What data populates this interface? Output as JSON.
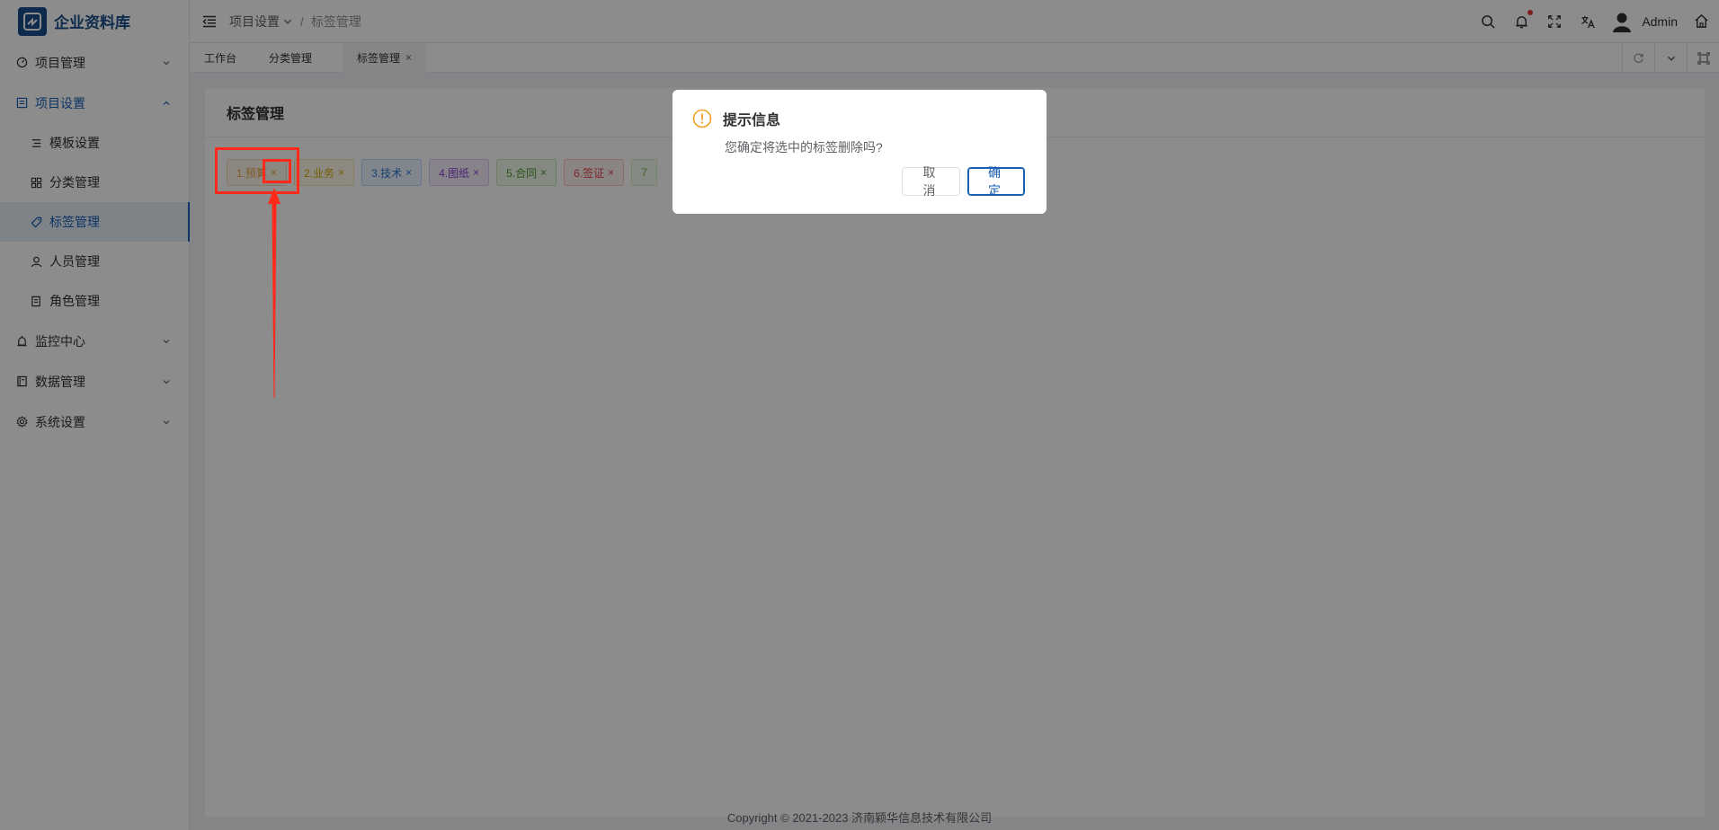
{
  "app": {
    "title": "企业资料库"
  },
  "sidebar": {
    "items": [
      {
        "label": "项目管理",
        "icon": "gauge-icon"
      },
      {
        "label": "项目设置",
        "icon": "document-icon"
      },
      {
        "label": "监控中心",
        "icon": "alarm-icon"
      },
      {
        "label": "数据管理",
        "icon": "book-icon"
      },
      {
        "label": "系统设置",
        "icon": "gear-icon"
      }
    ],
    "sub_items": [
      {
        "label": "模板设置",
        "icon": "list-icon"
      },
      {
        "label": "分类管理",
        "icon": "grid-icon"
      },
      {
        "label": "标签管理",
        "icon": "tag-icon"
      },
      {
        "label": "人员管理",
        "icon": "user-icon"
      },
      {
        "label": "角色管理",
        "icon": "role-icon"
      }
    ]
  },
  "header": {
    "breadcrumb": [
      "项目设置",
      "标签管理"
    ],
    "username": "Admin"
  },
  "tabs": [
    {
      "label": "工作台"
    },
    {
      "label": "分类管理"
    },
    {
      "label": "标签管理",
      "close": "×"
    }
  ],
  "page": {
    "title": "标签管理",
    "tags": [
      {
        "label": "1.预算",
        "color": "#e6a23c"
      },
      {
        "label": "2.业务",
        "color": "#e6c13c"
      },
      {
        "label": "3.技术",
        "color": "#409eff"
      },
      {
        "label": "4.图纸",
        "color": "#9254de"
      },
      {
        "label": "5.合同",
        "color": "#67c23a"
      },
      {
        "label": "6.签证",
        "color": "#f56c6c"
      },
      {
        "label": "7",
        "color": "#95d475"
      }
    ],
    "tag_close": "×"
  },
  "dialog": {
    "title": "提示信息",
    "message": "您确定将选中的标签删除吗?",
    "cancel": "取消",
    "confirm": "确定"
  },
  "footer": {
    "copyright": "Copyright © 2021-2023 济南颖华信息技术有限公司"
  },
  "colors": {
    "primary": "#1a5fb4",
    "annotation": "#ff2a1a",
    "warning": "#f0a020"
  }
}
